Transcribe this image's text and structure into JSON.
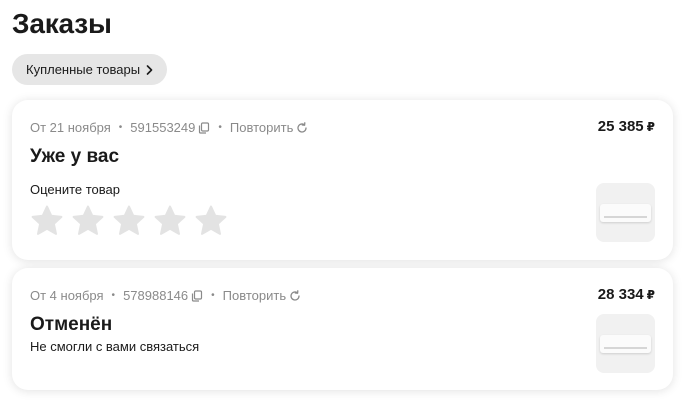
{
  "page": {
    "title": "Заказы",
    "filter_chip": "Купленные товары"
  },
  "orders": [
    {
      "date": "От 21 ноября",
      "number": "591553249",
      "repeat_label": "Повторить",
      "price": "25 385",
      "currency": "₽",
      "status": "Уже у вас",
      "rate_label": "Оцените товар",
      "stars_total": 5,
      "stars_filled": 0,
      "product_icon": "air-conditioner-icon"
    },
    {
      "date": "От 4 ноября",
      "number": "578988146",
      "repeat_label": "Повторить",
      "price": "28 334",
      "currency": "₽",
      "status": "Отменён",
      "status_note": "Не смогли с вами связаться",
      "product_icon": "air-conditioner-icon"
    }
  ],
  "colors": {
    "chip_bg": "#e6e6e6",
    "meta_text": "#8a8a8a",
    "star_empty": "#e3e3e3",
    "thumb_bg": "#f1f1f1"
  }
}
